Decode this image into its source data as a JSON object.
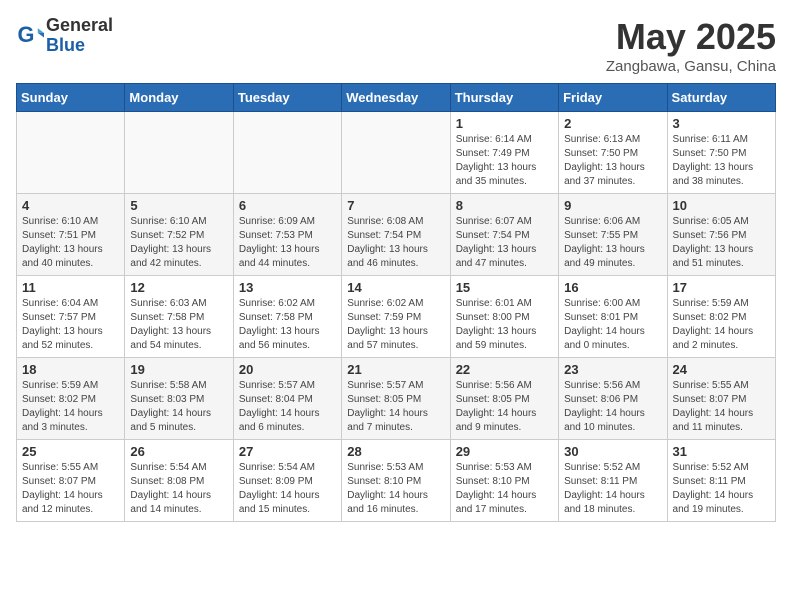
{
  "header": {
    "logo_general": "General",
    "logo_blue": "Blue",
    "title": "May 2025",
    "location": "Zangbawa, Gansu, China"
  },
  "weekdays": [
    "Sunday",
    "Monday",
    "Tuesday",
    "Wednesday",
    "Thursday",
    "Friday",
    "Saturday"
  ],
  "weeks": [
    [
      {
        "day": "",
        "info": ""
      },
      {
        "day": "",
        "info": ""
      },
      {
        "day": "",
        "info": ""
      },
      {
        "day": "",
        "info": ""
      },
      {
        "day": "1",
        "info": "Sunrise: 6:14 AM\nSunset: 7:49 PM\nDaylight: 13 hours\nand 35 minutes."
      },
      {
        "day": "2",
        "info": "Sunrise: 6:13 AM\nSunset: 7:50 PM\nDaylight: 13 hours\nand 37 minutes."
      },
      {
        "day": "3",
        "info": "Sunrise: 6:11 AM\nSunset: 7:50 PM\nDaylight: 13 hours\nand 38 minutes."
      }
    ],
    [
      {
        "day": "4",
        "info": "Sunrise: 6:10 AM\nSunset: 7:51 PM\nDaylight: 13 hours\nand 40 minutes."
      },
      {
        "day": "5",
        "info": "Sunrise: 6:10 AM\nSunset: 7:52 PM\nDaylight: 13 hours\nand 42 minutes."
      },
      {
        "day": "6",
        "info": "Sunrise: 6:09 AM\nSunset: 7:53 PM\nDaylight: 13 hours\nand 44 minutes."
      },
      {
        "day": "7",
        "info": "Sunrise: 6:08 AM\nSunset: 7:54 PM\nDaylight: 13 hours\nand 46 minutes."
      },
      {
        "day": "8",
        "info": "Sunrise: 6:07 AM\nSunset: 7:54 PM\nDaylight: 13 hours\nand 47 minutes."
      },
      {
        "day": "9",
        "info": "Sunrise: 6:06 AM\nSunset: 7:55 PM\nDaylight: 13 hours\nand 49 minutes."
      },
      {
        "day": "10",
        "info": "Sunrise: 6:05 AM\nSunset: 7:56 PM\nDaylight: 13 hours\nand 51 minutes."
      }
    ],
    [
      {
        "day": "11",
        "info": "Sunrise: 6:04 AM\nSunset: 7:57 PM\nDaylight: 13 hours\nand 52 minutes."
      },
      {
        "day": "12",
        "info": "Sunrise: 6:03 AM\nSunset: 7:58 PM\nDaylight: 13 hours\nand 54 minutes."
      },
      {
        "day": "13",
        "info": "Sunrise: 6:02 AM\nSunset: 7:58 PM\nDaylight: 13 hours\nand 56 minutes."
      },
      {
        "day": "14",
        "info": "Sunrise: 6:02 AM\nSunset: 7:59 PM\nDaylight: 13 hours\nand 57 minutes."
      },
      {
        "day": "15",
        "info": "Sunrise: 6:01 AM\nSunset: 8:00 PM\nDaylight: 13 hours\nand 59 minutes."
      },
      {
        "day": "16",
        "info": "Sunrise: 6:00 AM\nSunset: 8:01 PM\nDaylight: 14 hours\nand 0 minutes."
      },
      {
        "day": "17",
        "info": "Sunrise: 5:59 AM\nSunset: 8:02 PM\nDaylight: 14 hours\nand 2 minutes."
      }
    ],
    [
      {
        "day": "18",
        "info": "Sunrise: 5:59 AM\nSunset: 8:02 PM\nDaylight: 14 hours\nand 3 minutes."
      },
      {
        "day": "19",
        "info": "Sunrise: 5:58 AM\nSunset: 8:03 PM\nDaylight: 14 hours\nand 5 minutes."
      },
      {
        "day": "20",
        "info": "Sunrise: 5:57 AM\nSunset: 8:04 PM\nDaylight: 14 hours\nand 6 minutes."
      },
      {
        "day": "21",
        "info": "Sunrise: 5:57 AM\nSunset: 8:05 PM\nDaylight: 14 hours\nand 7 minutes."
      },
      {
        "day": "22",
        "info": "Sunrise: 5:56 AM\nSunset: 8:05 PM\nDaylight: 14 hours\nand 9 minutes."
      },
      {
        "day": "23",
        "info": "Sunrise: 5:56 AM\nSunset: 8:06 PM\nDaylight: 14 hours\nand 10 minutes."
      },
      {
        "day": "24",
        "info": "Sunrise: 5:55 AM\nSunset: 8:07 PM\nDaylight: 14 hours\nand 11 minutes."
      }
    ],
    [
      {
        "day": "25",
        "info": "Sunrise: 5:55 AM\nSunset: 8:07 PM\nDaylight: 14 hours\nand 12 minutes."
      },
      {
        "day": "26",
        "info": "Sunrise: 5:54 AM\nSunset: 8:08 PM\nDaylight: 14 hours\nand 14 minutes."
      },
      {
        "day": "27",
        "info": "Sunrise: 5:54 AM\nSunset: 8:09 PM\nDaylight: 14 hours\nand 15 minutes."
      },
      {
        "day": "28",
        "info": "Sunrise: 5:53 AM\nSunset: 8:10 PM\nDaylight: 14 hours\nand 16 minutes."
      },
      {
        "day": "29",
        "info": "Sunrise: 5:53 AM\nSunset: 8:10 PM\nDaylight: 14 hours\nand 17 minutes."
      },
      {
        "day": "30",
        "info": "Sunrise: 5:52 AM\nSunset: 8:11 PM\nDaylight: 14 hours\nand 18 minutes."
      },
      {
        "day": "31",
        "info": "Sunrise: 5:52 AM\nSunset: 8:11 PM\nDaylight: 14 hours\nand 19 minutes."
      }
    ]
  ]
}
